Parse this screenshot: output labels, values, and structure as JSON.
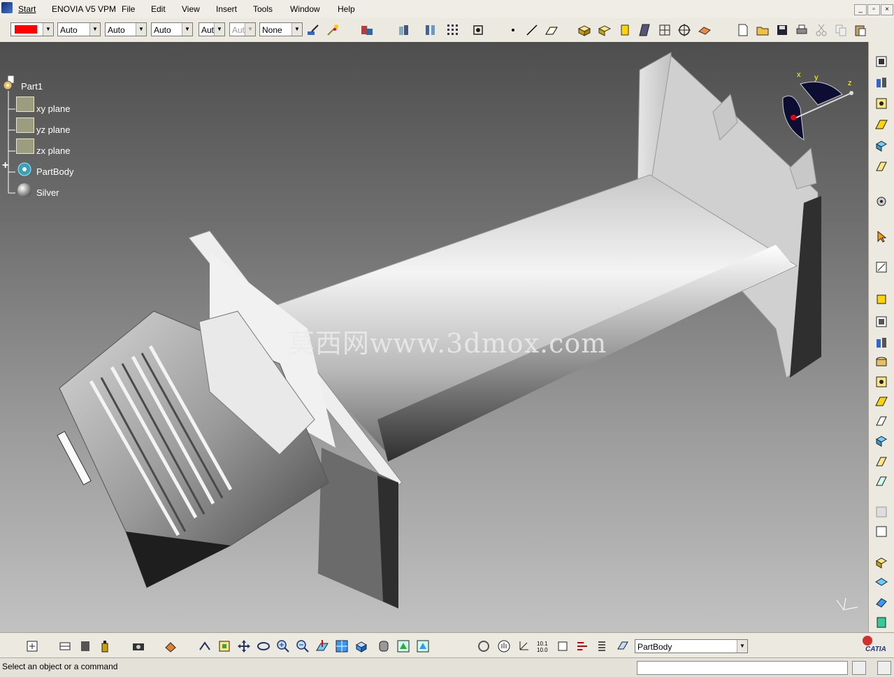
{
  "menubar": {
    "start": "Start",
    "app": "ENOVIA V5 VPM",
    "file": "File",
    "edit": "Edit",
    "view": "View",
    "insert": "Insert",
    "tools": "Tools",
    "window": "Window",
    "help": "Help"
  },
  "window_controls": {
    "minimize": "_",
    "restore": "▫",
    "close": "×"
  },
  "graphic_props": {
    "color_value": "#ff0000",
    "transparency": "Auto",
    "line_thickness": "Auto",
    "line_type": "Auto",
    "point_type": "Aut",
    "layer": "Aut",
    "layer_name": "None"
  },
  "tree": {
    "root": "Part1",
    "items": [
      {
        "label": "xy plane",
        "icon": "plane-icon"
      },
      {
        "label": "yz plane",
        "icon": "plane-icon"
      },
      {
        "label": "zx plane",
        "icon": "plane-icon"
      },
      {
        "label": "PartBody",
        "icon": "body-gear-icon"
      },
      {
        "label": "Silver",
        "icon": "material-sphere-icon"
      }
    ],
    "expand_symbol": "+"
  },
  "compass": {
    "x": "x",
    "y": "y",
    "z": "z"
  },
  "watermark": "莫西网www.3dmox.com",
  "bottom": {
    "current_body": "PartBody"
  },
  "status": {
    "message": "Select an object or a command"
  },
  "brand": "CATIA",
  "colors": {
    "viewport_top": "#4e4e4e",
    "viewport_bottom": "#c2c2c2",
    "accent_red": "#ff0000"
  }
}
